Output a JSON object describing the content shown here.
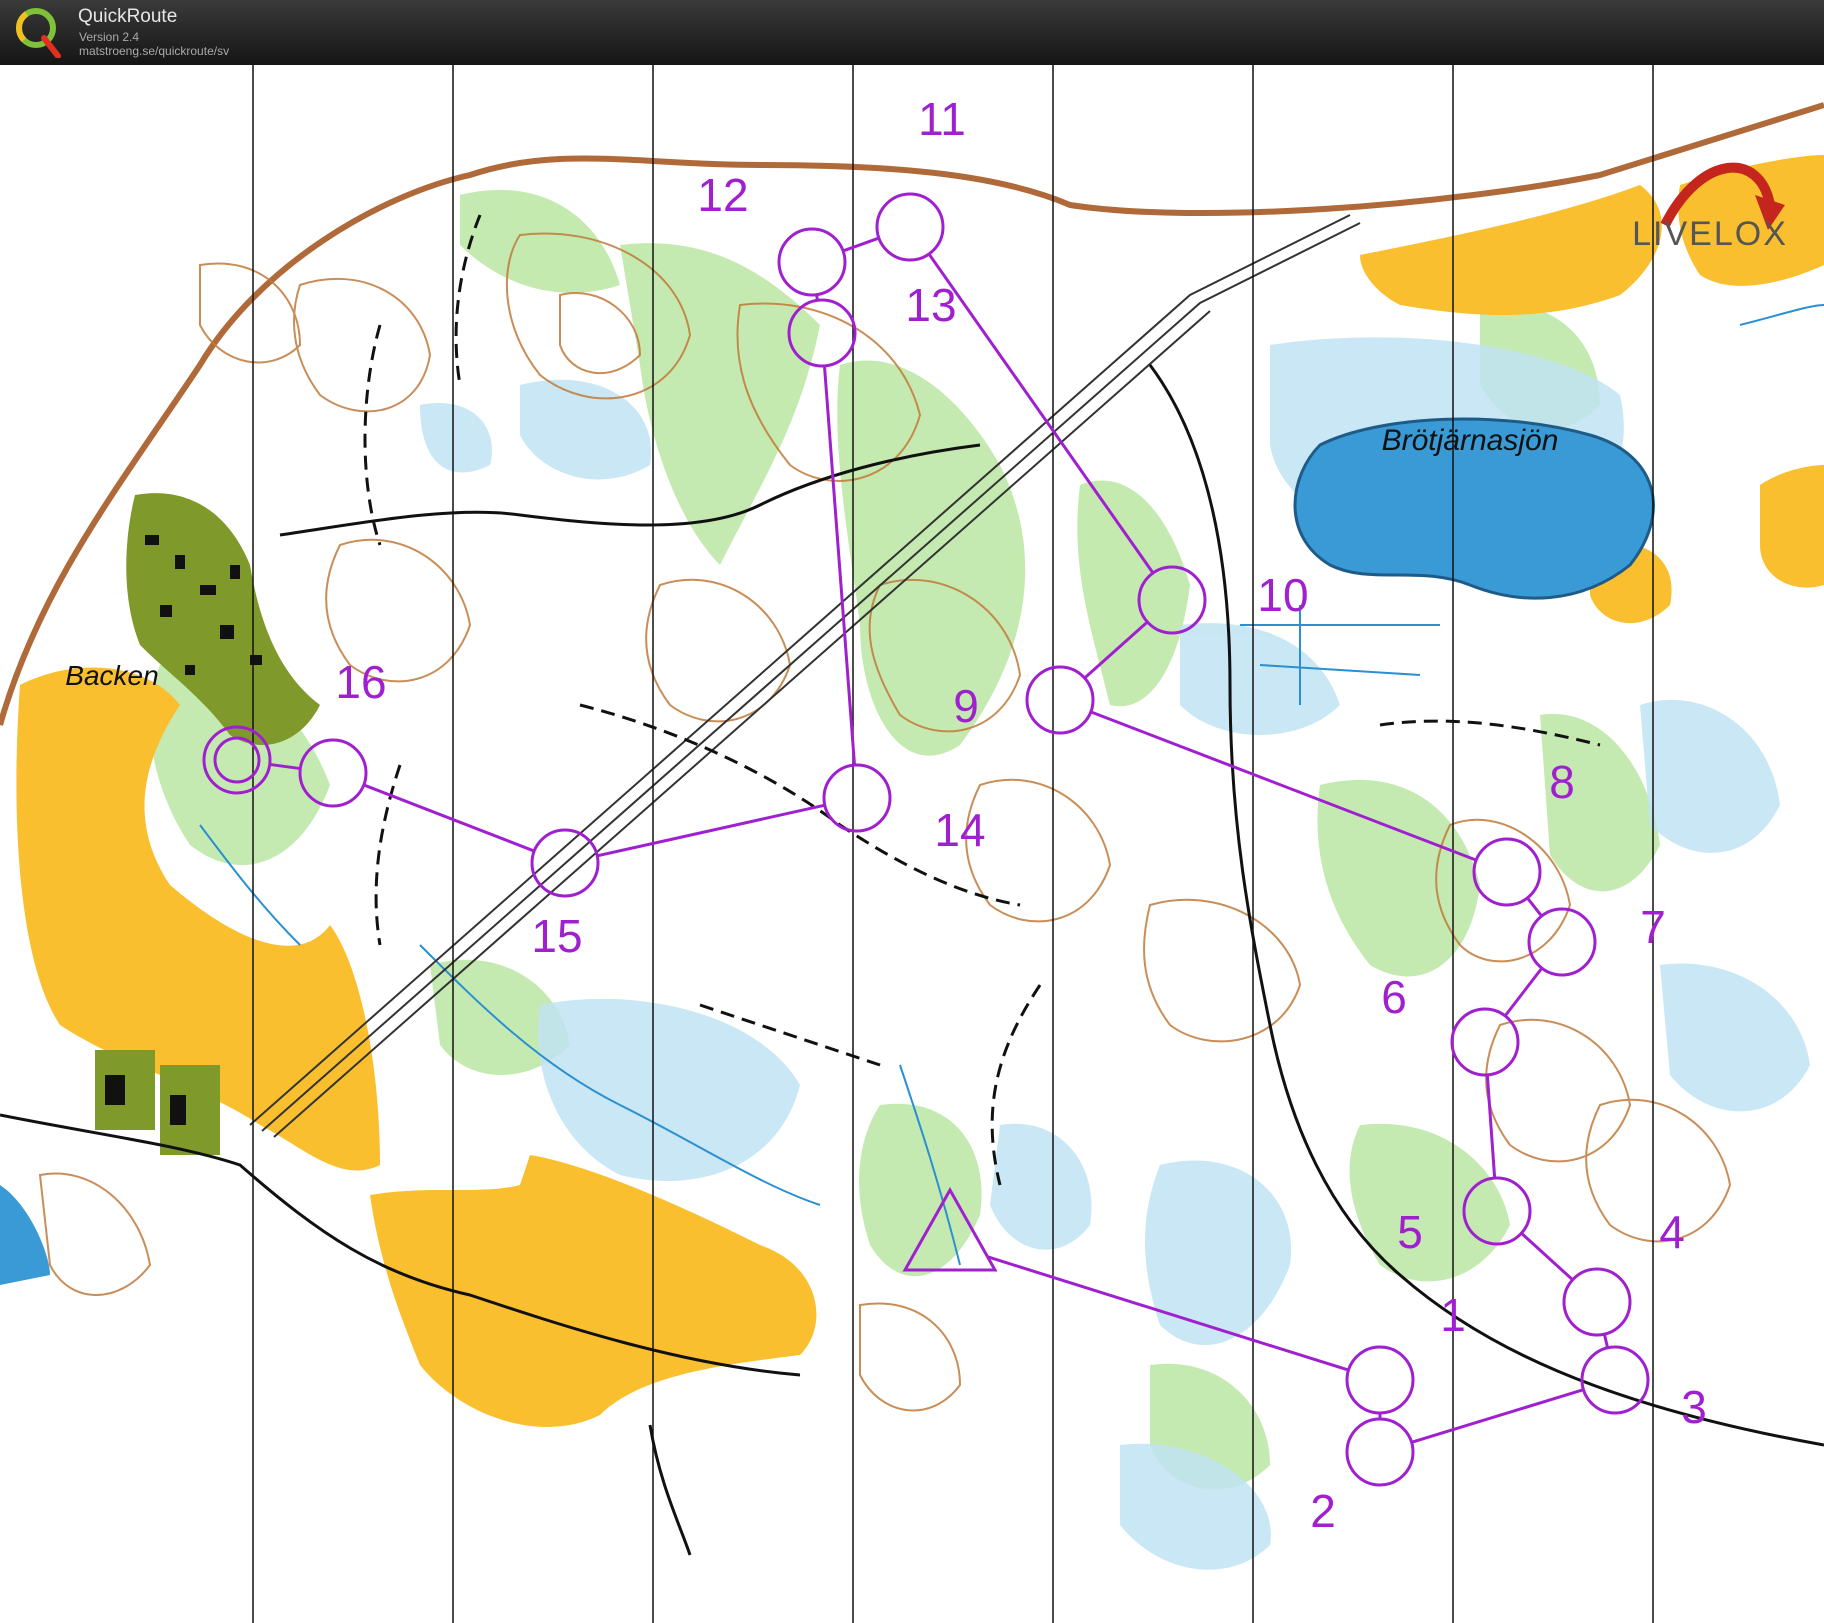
{
  "app": {
    "title": "QuickRoute",
    "version": "Version 2.4",
    "url": "matstroeng.se/quickroute/sv"
  },
  "map": {
    "lake_name": "Brötjärnasjön",
    "village_name": "Backen",
    "watermark": "LIVELOX",
    "course_color": "#a020d0"
  },
  "course": {
    "start": "start",
    "controls": [
      {
        "label": "1"
      },
      {
        "label": "2"
      },
      {
        "label": "3"
      },
      {
        "label": "4"
      },
      {
        "label": "5"
      },
      {
        "label": "6"
      },
      {
        "label": "7"
      },
      {
        "label": "8"
      },
      {
        "label": "9"
      },
      {
        "label": "10"
      },
      {
        "label": "11"
      },
      {
        "label": "12"
      },
      {
        "label": "13"
      },
      {
        "label": "14"
      },
      {
        "label": "15"
      },
      {
        "label": "16"
      }
    ]
  }
}
